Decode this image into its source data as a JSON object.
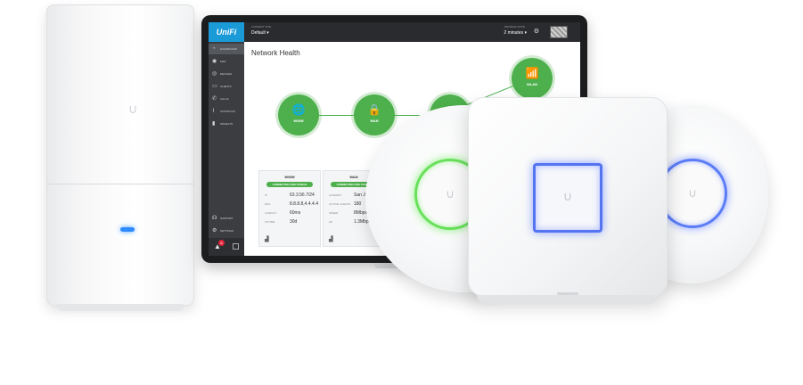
{
  "app": {
    "brand": "UniFi",
    "current_site_label": "CURRENT SITE",
    "current_site": "Default ▾",
    "refresh_label": "REFRESH RATE",
    "refresh_value": "2 minutes ▾",
    "icons": {
      "settings": "gear-icon",
      "avatar": "user-avatar"
    }
  },
  "sidebar": {
    "items": [
      {
        "label": "DASHBOARD",
        "icon": "◔"
      },
      {
        "label": "MAP",
        "icon": "◉"
      },
      {
        "label": "DEVICES",
        "icon": "◎"
      },
      {
        "label": "CLIENTS",
        "icon": "▭"
      },
      {
        "label": "CALLS",
        "icon": "✆"
      },
      {
        "label": "STATISTICS",
        "icon": "⌇"
      },
      {
        "label": "INSIGHTS",
        "icon": "▮"
      }
    ],
    "bottom_items": [
      {
        "label": "SUPPORT",
        "icon": "☊"
      },
      {
        "label": "SETTINGS",
        "icon": "⚙"
      }
    ],
    "alert_count": "6"
  },
  "main": {
    "title": "Network Health",
    "nodes": [
      {
        "label": "WWW",
        "icon": "🌐"
      },
      {
        "label": "WAN",
        "icon": "🔒"
      },
      {
        "label": "",
        "icon": "▯"
      },
      {
        "label": "WLAN",
        "icon": "📶"
      }
    ],
    "cards": [
      {
        "title": "WWW",
        "status": "CONNECTED AND STABLE",
        "rows": [
          {
            "label": "IP",
            "value": "63.3.56.7/24"
          },
          {
            "label": "DNS",
            "value": "8.8.8.8,4.4.4.4"
          },
          {
            "label": "LATENCY",
            "value": "60ms"
          },
          {
            "label": "UPTIME",
            "value": "30d"
          }
        ]
      },
      {
        "title": "WAN",
        "status": "CONNECTED AND STABLE",
        "rows": [
          {
            "label": "GATEWAY",
            "value": "San Jose"
          },
          {
            "label": "ACTIVE CLIENTS",
            "value": "180"
          },
          {
            "label": "SPEED",
            "value": "8Mbps"
          },
          {
            "label": "UP",
            "value": "1.3Mbps"
          }
        ]
      }
    ]
  },
  "colors": {
    "brand": "#1b9ad8",
    "healthy": "#4db04c",
    "led_blue": "#2f8cff",
    "ring_green": "#69e05c",
    "ring_blue": "#5b7cf5",
    "alert": "#e0263b"
  }
}
